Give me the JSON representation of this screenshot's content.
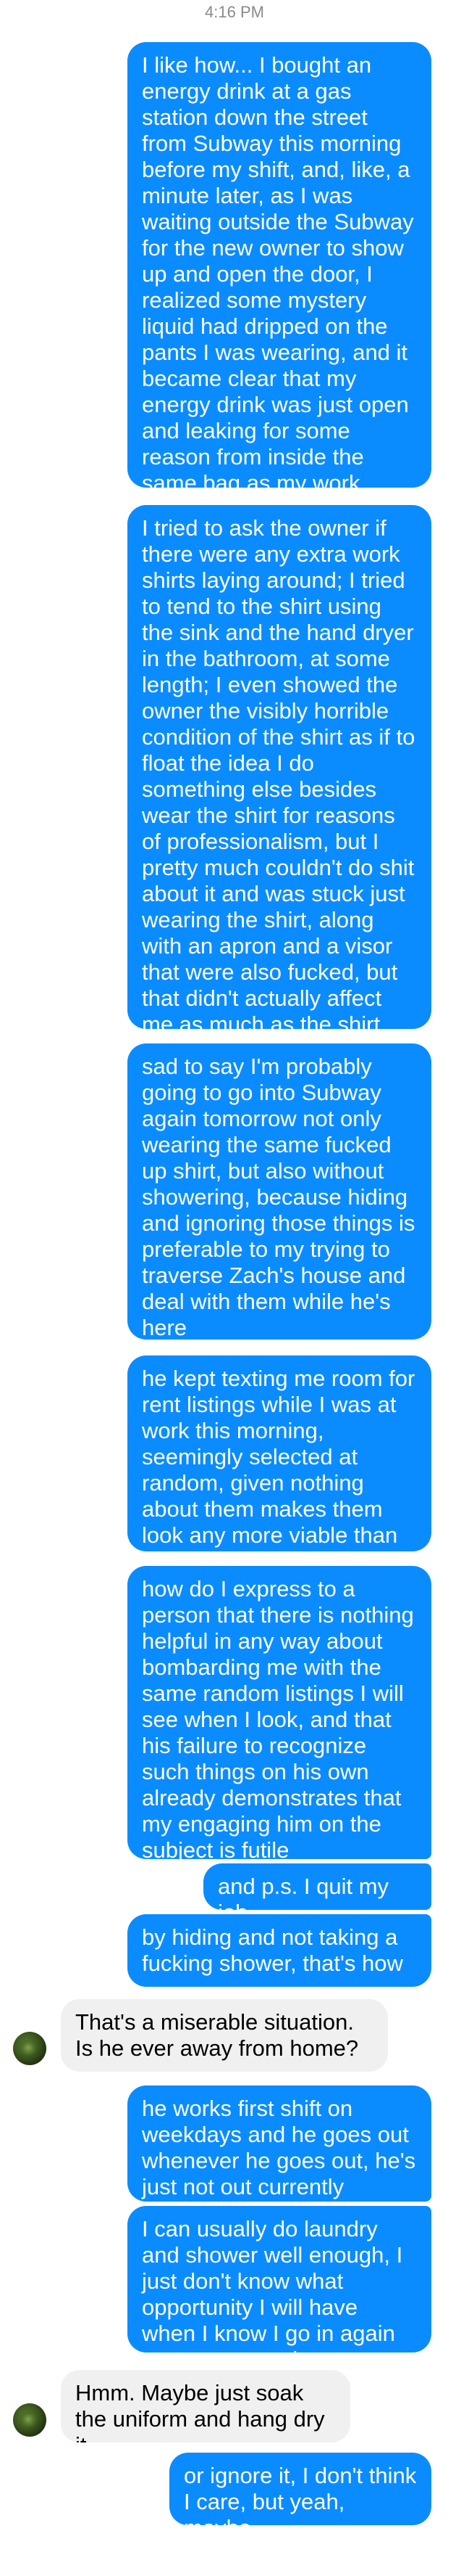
{
  "timestamp": "4:16 PM",
  "messages": [
    {
      "sender": "me",
      "text": "I like how... I bought an energy drink at a gas station down the street from Subway this morning before my shift, and, like, a minute later, as I was waiting outside the Subway for the new owner to show up and open the door, I realized some mystery liquid had dripped on the pants I was wearing, and it became clear that my energy drink was just open and leaking for some reason from inside the same bag as my work clothes"
    },
    {
      "sender": "me",
      "text": "I tried to ask the owner if there were any extra work shirts laying around; I tried to tend to the shirt using the sink and the hand dryer in the bathroom, at some length; I even showed the owner the visibly horrible condition of the shirt as if to float the idea I do something else besides wear the shirt for reasons of professionalism, but I pretty much couldn't do shit about it and was stuck just wearing the shirt, along with an apron and a visor that were also fucked, but that didn't actually affect me as much as the shirt"
    },
    {
      "sender": "me",
      "text": "sad to say I'm probably going to go into Subway again tomorrow not only wearing the same fucked up shirt, but also without showering, because hiding and ignoring those things is preferable to my trying to traverse Zach's house and deal with them while he's here"
    },
    {
      "sender": "me",
      "text": "he kept texting me room for rent listings while I was at work this morning, seemingly selected at random, given nothing about them makes them look any more viable than any others"
    },
    {
      "sender": "me",
      "text": "how do I express to a person that there is nothing helpful in any way about bombarding me with the same random listings I will see when I look, and that his failure to recognize such things on his own already demonstrates that my engaging him on the subject is futile"
    },
    {
      "sender": "me",
      "text": "and p.s. I quit my job"
    },
    {
      "sender": "me",
      "text": "by hiding and not taking a fucking shower, that's how"
    },
    {
      "sender": "them",
      "text": "That's a miserable situation. Is he ever away from home?"
    },
    {
      "sender": "me",
      "text": "he works first shift on weekdays and he goes out whenever he goes out, he's just not out currently"
    },
    {
      "sender": "me",
      "text": "I can usually do laundry and shower well enough, I just don't know what opportunity I will have when I know I go in again tomorrow morning"
    },
    {
      "sender": "them",
      "text": "Hmm. Maybe just soak the uniform and hang dry it."
    },
    {
      "sender": "me",
      "text": "or ignore it, I don't think I care, but yeah, maybe"
    }
  ],
  "colors": {
    "sent_bubble": "#0a8cff",
    "received_bubble": "#f0f0f0",
    "timestamp": "#8a8a8a"
  }
}
